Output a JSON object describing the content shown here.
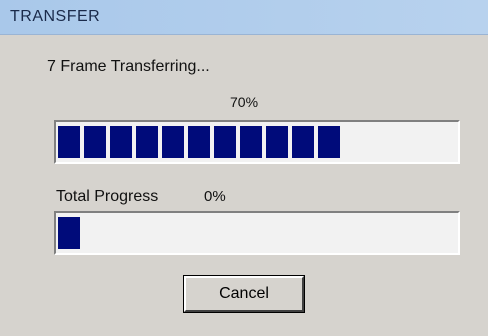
{
  "window": {
    "title": "TRANSFER"
  },
  "transfer": {
    "status_text": "7 Frame Transferring...",
    "current_percent_text": "70%",
    "current_progress": 0.7,
    "total_label": "Total Progress",
    "total_percent_text": "0%",
    "total_progress": 0.02
  },
  "buttons": {
    "cancel_label": "Cancel"
  },
  "colors": {
    "progress_fill": "#000b7a",
    "titlebar": "#a9c8ea"
  }
}
